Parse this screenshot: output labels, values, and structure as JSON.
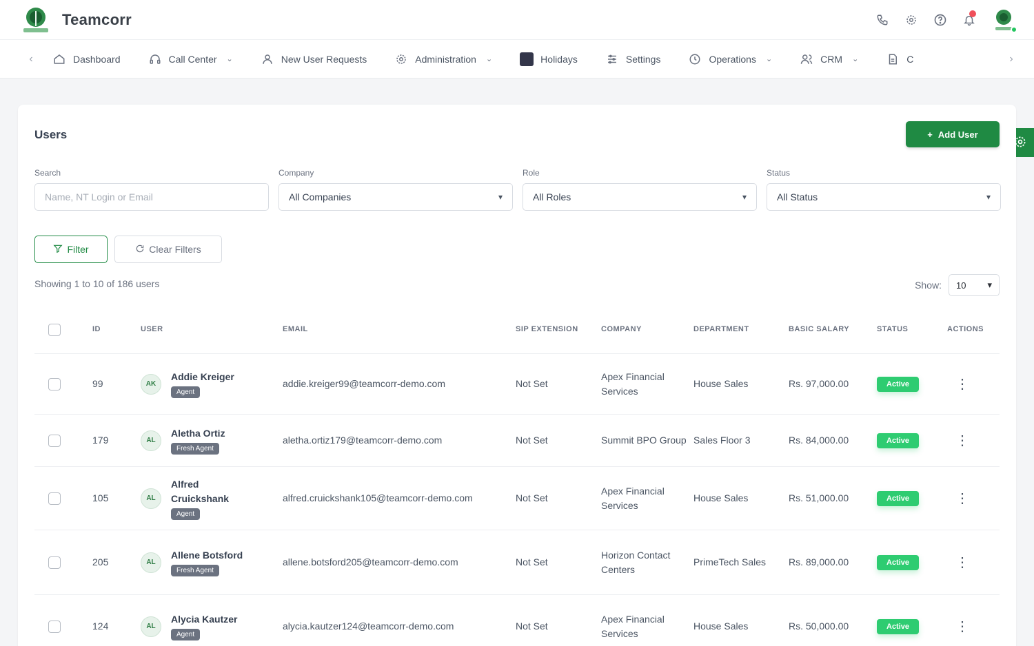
{
  "app": {
    "brand": "Teamcorr"
  },
  "colors": {
    "accent": "#1f8a43",
    "status_active": "#2ecc71",
    "role_badge": "#6b7280",
    "notification": "#f04f5a"
  },
  "topbar": {
    "icons": [
      "phone-icon",
      "gear-icon",
      "help-icon",
      "bell-icon",
      "user-avatar"
    ]
  },
  "nav": {
    "items": [
      {
        "label": "Dashboard",
        "icon": "home-icon",
        "dropdown": false
      },
      {
        "label": "Call Center",
        "icon": "headset-icon",
        "dropdown": true
      },
      {
        "label": "New User Requests",
        "icon": "user-plus-icon",
        "dropdown": false
      },
      {
        "label": "Administration",
        "icon": "cog-icon",
        "dropdown": true
      },
      {
        "label": "Holidays",
        "icon": "calendar-icon",
        "dropdown": false
      },
      {
        "label": "Settings",
        "icon": "settings-icon",
        "dropdown": false
      },
      {
        "label": "Operations",
        "icon": "clock-icon",
        "dropdown": true
      },
      {
        "label": "CRM",
        "icon": "people-icon",
        "dropdown": true
      },
      {
        "label": "C",
        "icon": "document-icon",
        "dropdown": false
      }
    ]
  },
  "page": {
    "title": "Users",
    "add_button": "Add User",
    "filters": {
      "search_label": "Search",
      "search_placeholder": "Name, NT Login or Email",
      "company_label": "Company",
      "company_value": "All Companies",
      "role_label": "Role",
      "role_value": "All Roles",
      "status_label": "Status",
      "status_value": "All Status"
    },
    "filter_button": "Filter",
    "clear_button": "Clear Filters",
    "showing_text": "Showing 1 to 10 of 186 users",
    "show_label": "Show:",
    "show_value": "10"
  },
  "table": {
    "headers": {
      "id": "ID",
      "user": "USER",
      "email": "EMAIL",
      "sip": "SIP EXTENSION",
      "company": "COMPANY",
      "department": "DEPARTMENT",
      "salary": "BASIC SALARY",
      "status": "STATUS",
      "actions": "ACTIONS"
    },
    "rows": [
      {
        "id": "99",
        "initials": "AK",
        "name": "Addie Kreiger",
        "role": "Agent",
        "email": "addie.kreiger99@teamcorr-demo.com",
        "sip": "Not Set",
        "company": "Apex Financial Services",
        "department": "House Sales",
        "salary": "Rs. 97,000.00",
        "status": "Active"
      },
      {
        "id": "179",
        "initials": "AL",
        "name": "Aletha Ortiz",
        "role": "Fresh Agent",
        "email": "aletha.ortiz179@teamcorr-demo.com",
        "sip": "Not Set",
        "company": "Summit BPO Group",
        "department": "Sales Floor 3",
        "salary": "Rs. 84,000.00",
        "status": "Active"
      },
      {
        "id": "105",
        "initials": "AL",
        "name": "Alfred Cruickshank",
        "role": "Agent",
        "email": "alfred.cruickshank105@teamcorr-demo.com",
        "sip": "Not Set",
        "company": "Apex Financial Services",
        "department": "House Sales",
        "salary": "Rs. 51,000.00",
        "status": "Active"
      },
      {
        "id": "205",
        "initials": "AL",
        "name": "Allene Botsford",
        "role": "Fresh Agent",
        "email": "allene.botsford205@teamcorr-demo.com",
        "sip": "Not Set",
        "company": "Horizon Contact Centers",
        "department": "PrimeTech Sales",
        "salary": "Rs. 89,000.00",
        "status": "Active"
      },
      {
        "id": "124",
        "initials": "AL",
        "name": "Alycia Kautzer",
        "role": "Agent",
        "email": "alycia.kautzer124@teamcorr-demo.com",
        "sip": "Not Set",
        "company": "Apex Financial Services",
        "department": "House Sales",
        "salary": "Rs. 50,000.00",
        "status": "Active"
      }
    ]
  }
}
